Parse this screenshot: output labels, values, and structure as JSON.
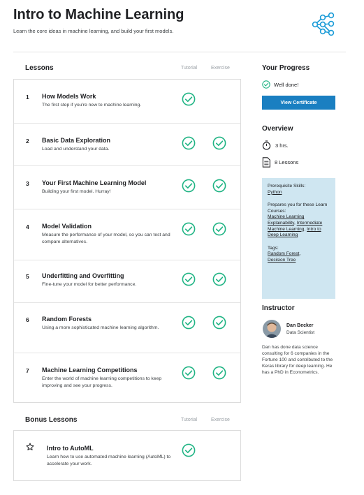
{
  "course": {
    "title": "Intro to Machine Learning",
    "subtitle": "Learn the core ideas in machine learning, and build your first models."
  },
  "lessons_section": {
    "title": "Lessons",
    "col_tutorial": "Tutorial",
    "col_exercise": "Exercise",
    "items": [
      {
        "num": "1",
        "title": "How Models Work",
        "desc": "The first step if you're new to machine learning.",
        "tutorial_done": true,
        "exercise_done": false
      },
      {
        "num": "2",
        "title": "Basic Data Exploration",
        "desc": "Load and understand your data.",
        "tutorial_done": true,
        "exercise_done": true
      },
      {
        "num": "3",
        "title": "Your First Machine Learning Model",
        "desc": "Building your first model. Hurray!",
        "tutorial_done": true,
        "exercise_done": true
      },
      {
        "num": "4",
        "title": "Model Validation",
        "desc": "Measure the performance of your model, so you can test and compare alternatives.",
        "tutorial_done": true,
        "exercise_done": true
      },
      {
        "num": "5",
        "title": "Underfitting and Overfitting",
        "desc": "Fine-tune your model for better performance.",
        "tutorial_done": true,
        "exercise_done": true
      },
      {
        "num": "6",
        "title": "Random Forests",
        "desc": "Using a more sophisticated machine learning algorithm.",
        "tutorial_done": true,
        "exercise_done": true
      },
      {
        "num": "7",
        "title": "Machine Learning Competitions",
        "desc": "Enter the world of machine learning competitions to keep improving and see your progress.",
        "tutorial_done": true,
        "exercise_done": true
      }
    ]
  },
  "bonus_section": {
    "title": "Bonus Lessons",
    "col_tutorial": "Tutorial",
    "col_exercise": "Exercise",
    "item": {
      "title": "Intro to AutoML",
      "desc": "Learn how to use automated machine learning (AutoML) to accelerate your work.",
      "tutorial_done": true
    }
  },
  "progress": {
    "title": "Your Progress",
    "status": "Well done!",
    "button": "View Certificate"
  },
  "overview": {
    "title": "Overview",
    "duration": "3 hrs.",
    "lessons": "8 Lessons"
  },
  "info": {
    "prereq_label": "Prerequisite Skills:",
    "prereq_link": "Python",
    "prepares_label": "Prepares you for these Learn Courses:",
    "prepares_links": [
      "Machine Learning Explainability",
      "Intermediate Machine Learning",
      "Intro to Deep Learning"
    ],
    "tags_label": "Tags:",
    "tags": [
      "Random Forest",
      "Decision Tree"
    ]
  },
  "instructor": {
    "title": "Instructor",
    "name": "Dan Becker",
    "role": "Data Scientist",
    "bio": "Dan has done data science consulting for 6 companies in the Fortune 100 and contributed to the Keras library for deep learning. He has a PhD in Econometrics."
  },
  "colors": {
    "check": "#20b484",
    "button": "#1a7fc1",
    "info_bg": "#cfe6f1",
    "share_icon": "#1a9bd7"
  }
}
